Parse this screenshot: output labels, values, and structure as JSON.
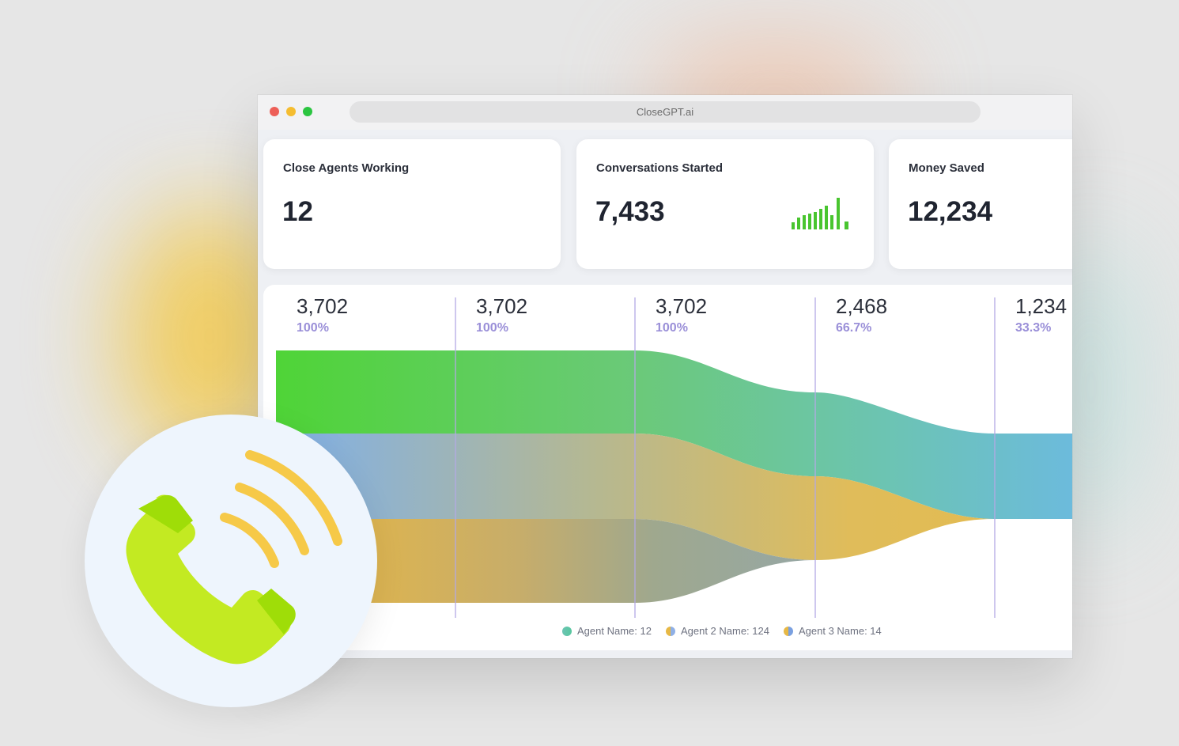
{
  "browser": {
    "url": "CloseGPT.ai",
    "traffic_lights": [
      "close",
      "minimize",
      "zoom"
    ]
  },
  "cards": [
    {
      "label": "Close Agents Working",
      "value": "12"
    },
    {
      "label": "Conversations Started",
      "value": "7,433",
      "sparkline_icon": "bar-sparkline-icon"
    },
    {
      "label": "Money Saved",
      "value": "12,234"
    }
  ],
  "sankey": {
    "stages": [
      {
        "value": "3,702",
        "percent": "100%"
      },
      {
        "value": "3,702",
        "percent": "100%"
      },
      {
        "value": "3,702",
        "percent": "100%"
      },
      {
        "value": "2,468",
        "percent": "66.7%"
      },
      {
        "value": "1,234",
        "percent": "33.3%"
      }
    ],
    "legend": [
      {
        "label": "Agent Name: 12"
      },
      {
        "label": "Agent 2 Name: 124"
      },
      {
        "label": "Agent 3 Name: 14"
      }
    ]
  },
  "colors": {
    "green": "#58d23f",
    "teal": "#6cc4b2",
    "blue": "#7db3e6",
    "gold": "#e7b845",
    "purple_pct": "#9a8fd8",
    "phone_green": "#b7e51f",
    "phone_waves": "#f6c948"
  },
  "icons": {
    "phone": "phone-call-icon"
  }
}
